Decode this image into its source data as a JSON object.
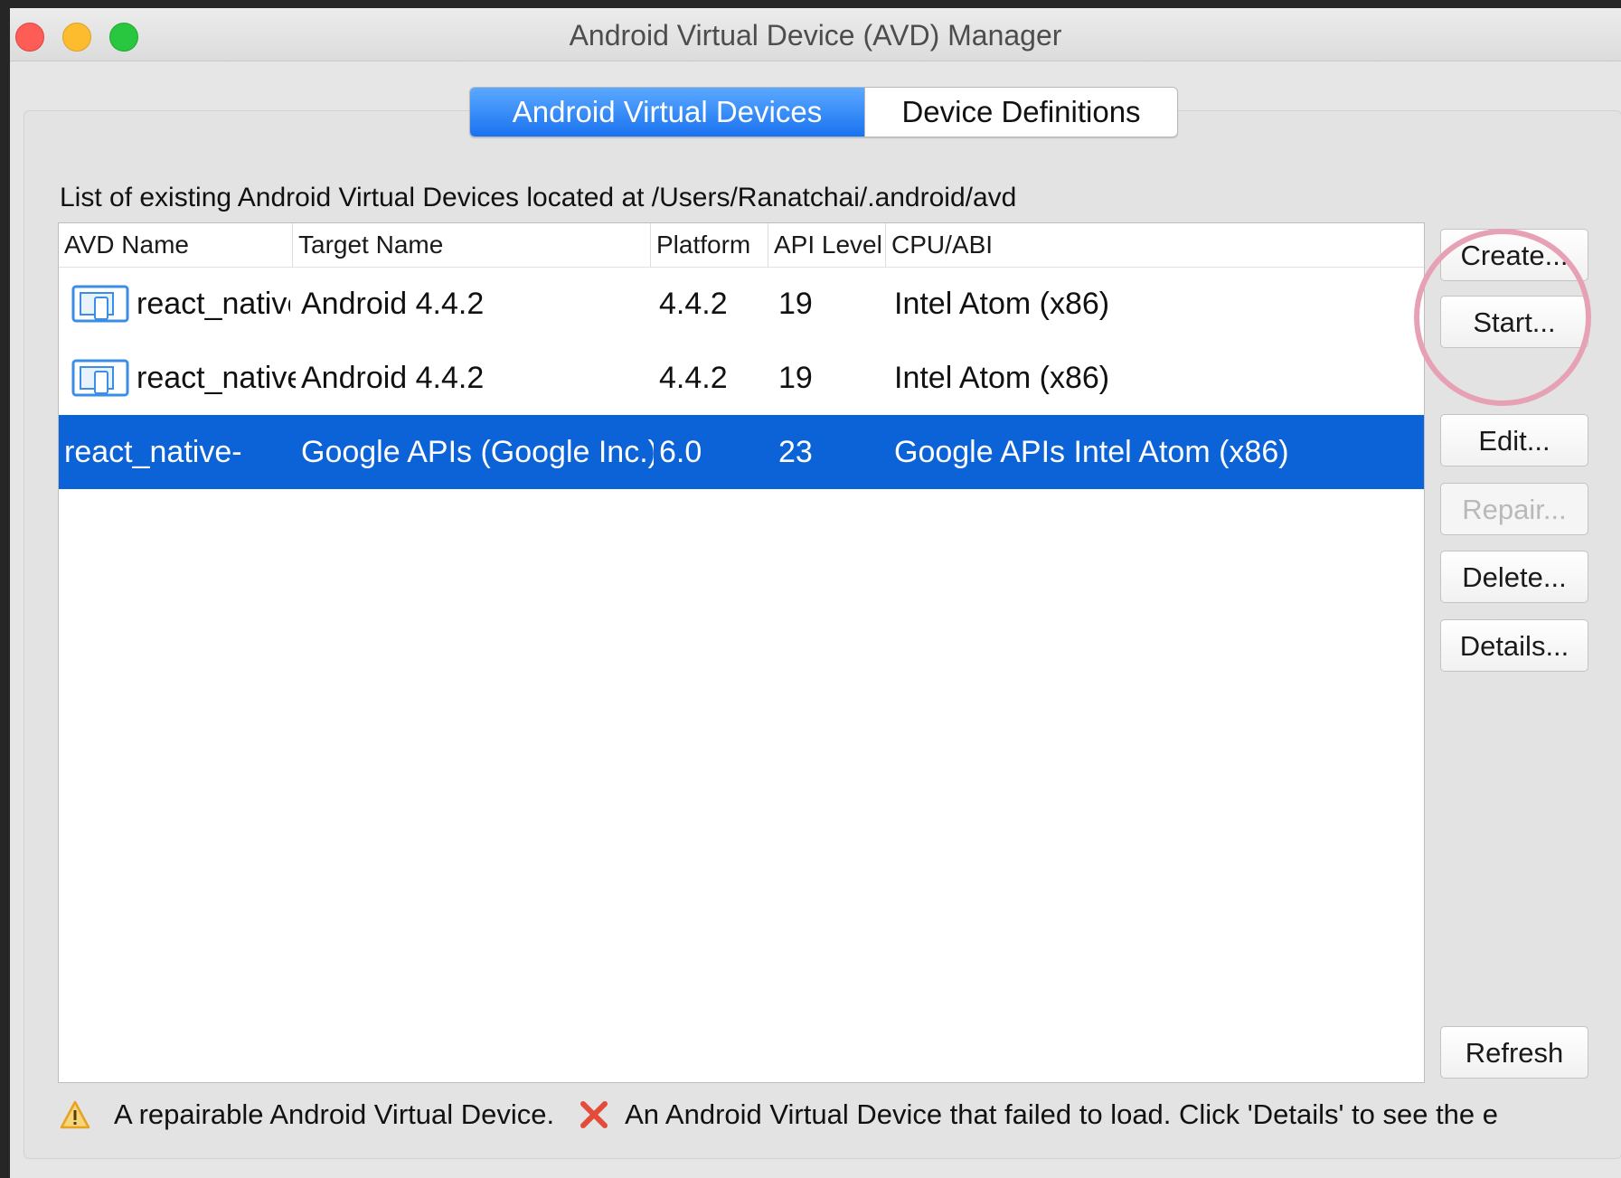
{
  "window": {
    "title": "Android Virtual Device (AVD) Manager"
  },
  "tabs": [
    {
      "label": "Android Virtual Devices",
      "active": true
    },
    {
      "label": "Device Definitions",
      "active": false
    }
  ],
  "list_caption": "List of existing Android Virtual Devices located at /Users/Ranatchai/.android/avd",
  "table": {
    "columns": [
      "AVD Name",
      "Target Name",
      "Platform",
      "API Level",
      "CPU/ABI"
    ],
    "rows": [
      {
        "icon": "device-icon",
        "name": "react_native",
        "target": "Android 4.4.2",
        "platform": "4.4.2",
        "api": "19",
        "cpu": "Intel Atom (x86)",
        "selected": false
      },
      {
        "icon": "device-icon",
        "name": "react_native_",
        "target": "Android 4.4.2",
        "platform": "4.4.2",
        "api": "19",
        "cpu": "Intel Atom (x86)",
        "selected": false
      },
      {
        "icon": "",
        "name": "react_native-",
        "target": "Google APIs (Google Inc.)",
        "platform": "6.0",
        "api": "23",
        "cpu": "Google APIs Intel Atom (x86)",
        "selected": true
      }
    ]
  },
  "buttons": {
    "create": "Create...",
    "start": "Start...",
    "edit": "Edit...",
    "repair": "Repair...",
    "delete": "Delete...",
    "details": "Details...",
    "refresh": "Refresh"
  },
  "legend": {
    "repairable": "A repairable Android Virtual Device.",
    "failed": "An Android Virtual Device that failed to load. Click 'Details' to see the e"
  },
  "colors": {
    "accent": "#0c63d8",
    "highlight_circle": "#e7a1b5",
    "warning": "#e8a21d",
    "error": "#e34b3a"
  }
}
